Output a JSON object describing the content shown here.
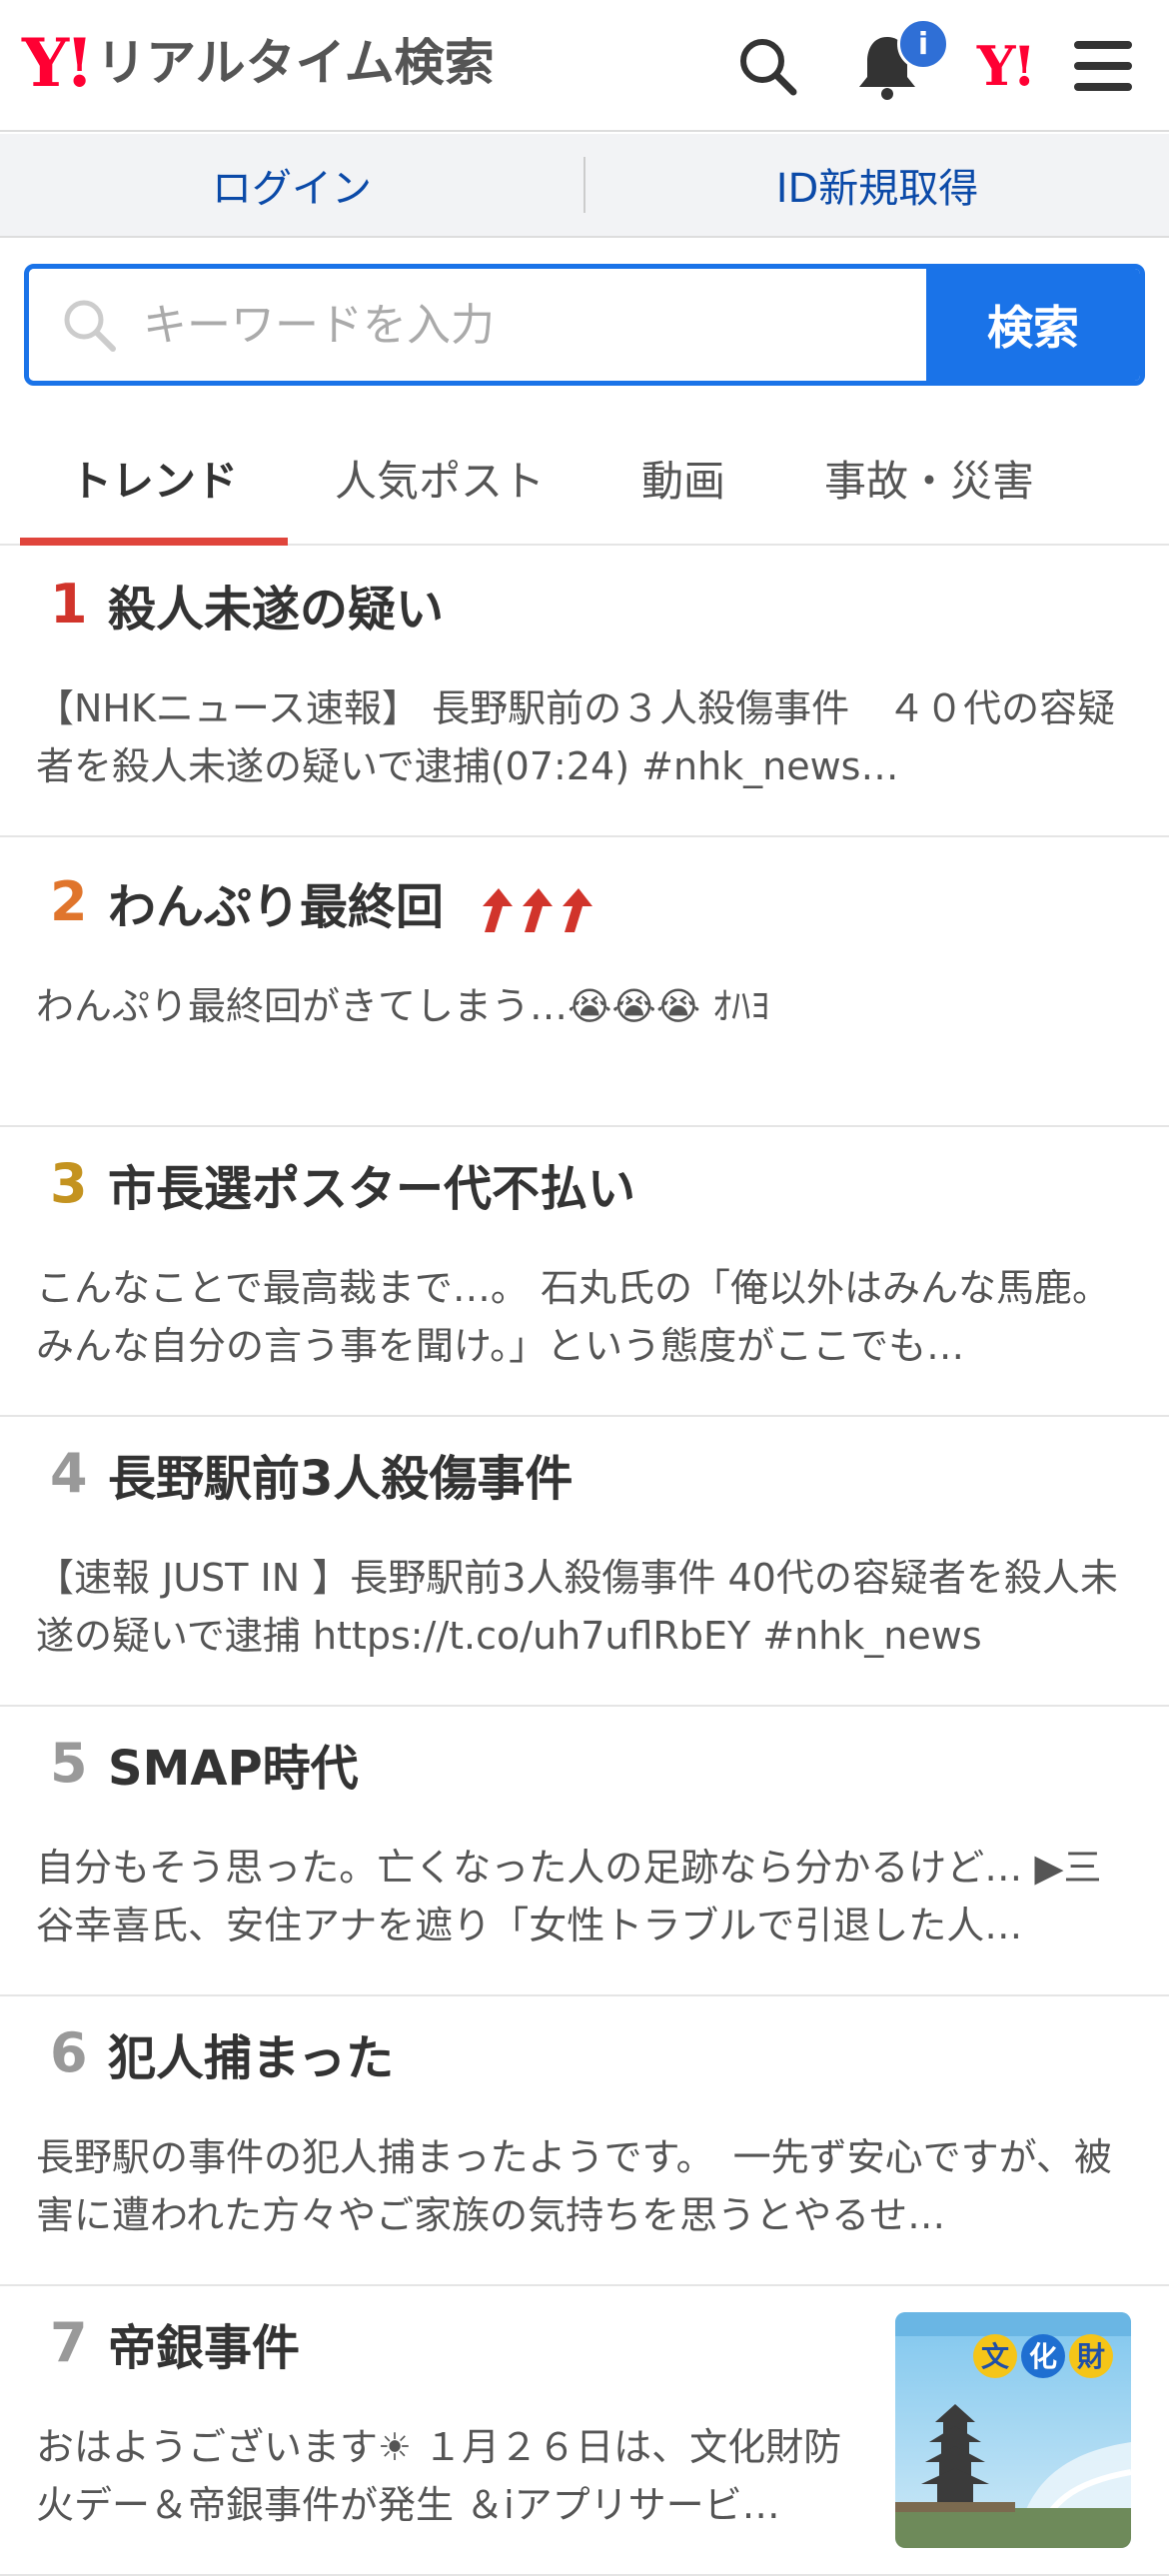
{
  "header": {
    "logo_mark": "Y!",
    "logo_text": "リアルタイム検索",
    "notification_badge": "i",
    "yj_mark": "Y!"
  },
  "account": {
    "login_label": "ログイン",
    "signup_label": "ID新規取得"
  },
  "search": {
    "placeholder": "キーワードを入力",
    "button_label": "検索"
  },
  "tabs": [
    {
      "label": "トレンド",
      "active": true
    },
    {
      "label": "人気ポスト",
      "active": false
    },
    {
      "label": "動画",
      "active": false
    },
    {
      "label": "事故・災害",
      "active": false
    }
  ],
  "colors": {
    "accent_blue": "#1a73e8",
    "rank1": "#d1342b",
    "rank2": "#e0752c",
    "rank3": "#c49320",
    "rank_other": "#999999",
    "tab_underline": "#e0453c"
  },
  "trends": [
    {
      "rank": "1",
      "title": "殺人未遂の疑い",
      "desc": "【NHKニュース速報】 長野駅前の３人殺傷事件　４０代の容疑者を殺人未遂の疑いで逮捕(07:24) #nhk_news…"
    },
    {
      "rank": "2",
      "title": "わんぷり最終回",
      "rising": true,
      "desc": "わんぷり最終回がきてしまう…😭😭😭 ｵﾊﾖ"
    },
    {
      "rank": "3",
      "title": "市長選ポスター代不払い",
      "desc": "こんなことで最高裁まで…。 石丸氏の「俺以外はみんな馬鹿。みんな自分の言う事を聞け。」という態度がここでも…"
    },
    {
      "rank": "4",
      "title": "長野駅前3人殺傷事件",
      "desc": "【速報 JUST IN 】長野駅前3人殺傷事件 40代の容疑者を殺人未遂の疑いで逮捕 https://t.co/uh7uflRbEY #nhk_news"
    },
    {
      "rank": "5",
      "title": "SMAP時代",
      "desc": "自分もそう思った。亡くなった人の足跡なら分かるけど… ▶三谷幸喜氏、安住アナを遮り「女性トラブルで引退した人…"
    },
    {
      "rank": "6",
      "title": "犯人捕まった",
      "desc": "長野駅の事件の犯人捕まったようです。　一先ず安心ですが、被害に遭われた方々やご家族の気持ちを思うとやるせ…"
    },
    {
      "rank": "7",
      "title": "帝銀事件",
      "desc": "おはようございます☀ １月２６日は、文化財防火デー＆帝銀事件が発生 ＆iアプリサービ…",
      "thumb_text": [
        "文",
        "化",
        "財"
      ]
    }
  ]
}
